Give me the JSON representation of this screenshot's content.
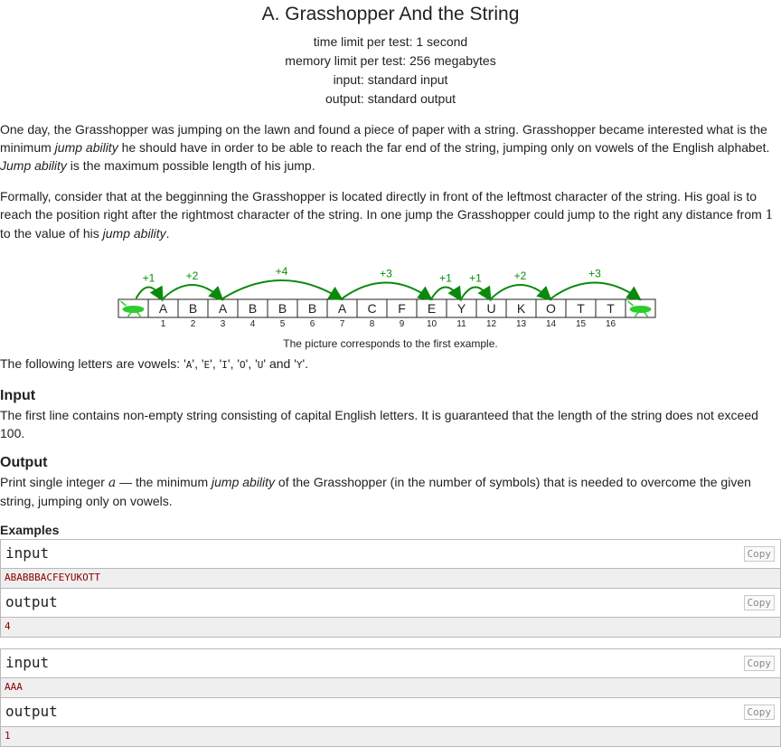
{
  "problem": {
    "title": "A. Grasshopper And the String",
    "limits": [
      "time limit per test: 1 second",
      "memory limit per test: 256 megabytes",
      "input: standard input",
      "output: standard output"
    ]
  },
  "statement": {
    "p1": {
      "a": "One day, the Grasshopper was jumping on the lawn and found a piece of paper with a string. Grasshopper became interested what is the minimum ",
      "b": "jump ability",
      "c": " he should have in order to be able to reach the far end of the string, jumping only on vowels of the English alphabet. ",
      "d": "Jump ability",
      "e": " is the maximum possible length of his jump."
    },
    "p2": {
      "a": "Formally, consider that at the begginning the Grasshopper is located directly in front of the leftmost character of the string. His goal is to reach the position right after the rightmost character of the string. In one jump the Grasshopper could jump to the right any distance from ",
      "one": "1",
      "b": " to the value of his ",
      "c": "jump ability",
      "d": "."
    },
    "figure": {
      "letters": [
        "A",
        "B",
        "A",
        "B",
        "B",
        "B",
        "A",
        "C",
        "F",
        "E",
        "Y",
        "U",
        "K",
        "O",
        "T",
        "T"
      ],
      "numbers": [
        "1",
        "2",
        "3",
        "4",
        "5",
        "6",
        "7",
        "8",
        "9",
        "10",
        "11",
        "12",
        "13",
        "14",
        "15",
        "16"
      ],
      "jumps": [
        {
          "from": 0,
          "to": 1,
          "label": "+1"
        },
        {
          "from": 1,
          "to": 3,
          "label": "+2"
        },
        {
          "from": 3,
          "to": 7,
          "label": "+4"
        },
        {
          "from": 7,
          "to": 10,
          "label": "+3"
        },
        {
          "from": 10,
          "to": 11,
          "label": "+1"
        },
        {
          "from": 11,
          "to": 12,
          "label": "+1"
        },
        {
          "from": 12,
          "to": 14,
          "label": "+2"
        },
        {
          "from": 14,
          "to": 17,
          "label": "+3"
        }
      ],
      "arrow_color": "#0a8a0a",
      "grasshopper_color": "#2ecc2e",
      "caption": "The picture corresponds to the first example."
    },
    "vowels": {
      "pre": "The following letters are vowels: '",
      "list": [
        "A",
        "E",
        "I",
        "O",
        "U",
        "Y"
      ],
      "sep": "', '",
      "and": "' and '",
      "end": "'."
    }
  },
  "input_section": {
    "heading": "Input",
    "text": "The first line contains non-empty string consisting of capital English letters. It is guaranteed that the length of the string does not exceed 100."
  },
  "output_section": {
    "heading": "Output",
    "pre": "Print single integer ",
    "var": "a",
    "mid": " — the minimum ",
    "ja": "jump ability",
    "post": " of the Grasshopper (in the number of symbols) that is needed to overcome the given string, jumping only on vowels."
  },
  "examples": {
    "heading": "Examples",
    "copy_label": "Copy",
    "input_label": "input",
    "output_label": "output",
    "items": [
      {
        "input": "ABABBBACFEYUKOTT",
        "output": "4"
      },
      {
        "input": "AAA",
        "output": "1"
      }
    ]
  }
}
